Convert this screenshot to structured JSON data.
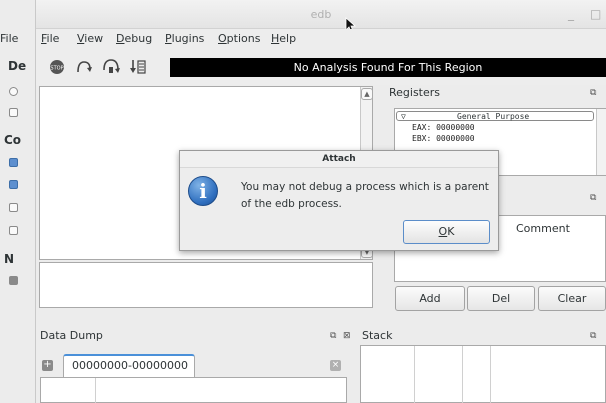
{
  "background_window": {
    "menu_label": "File",
    "partial_labels": [
      "De",
      "Co",
      "N"
    ]
  },
  "window": {
    "title": "edb",
    "minimize": "_",
    "close": "×"
  },
  "menubar": {
    "items": [
      {
        "text": "File",
        "u": "F",
        "rest": "ile"
      },
      {
        "text": "View",
        "u": "V",
        "rest": "iew"
      },
      {
        "text": "Debug",
        "u": "D",
        "rest": "ebug"
      },
      {
        "text": "Plugins",
        "u": "P",
        "rest": "lugins"
      },
      {
        "text": "Options",
        "u": "O",
        "rest": "ptions"
      },
      {
        "text": "Help",
        "u": "H",
        "rest": "elp"
      }
    ]
  },
  "toolbar": {
    "buttons": [
      "stop-icon",
      "step-into-icon",
      "step-over-icon",
      "step-out-icon"
    ],
    "analysis_text": "No Analysis Found For This Region"
  },
  "registers": {
    "title": "Registers",
    "group": "General Purpose",
    "rows": [
      "EAX: 00000000",
      "EBX: 00000000"
    ]
  },
  "comment_panel": {
    "comment_label": "Comment"
  },
  "breakpoint_buttons": {
    "add": "Add",
    "del": "Del",
    "clear": "Clear"
  },
  "data_dump": {
    "title": "Data Dump",
    "tab": "00000000-00000000"
  },
  "stack": {
    "title": "Stack"
  },
  "dialog": {
    "title": "Attach",
    "message": "You may not debug a process which is a parent of the edb process.",
    "ok_underline": "O",
    "ok_rest": "K"
  },
  "colors": {
    "accent": "#4a90d9",
    "info_icon": "#2f6fbf",
    "analysis_bar": "#000000"
  }
}
